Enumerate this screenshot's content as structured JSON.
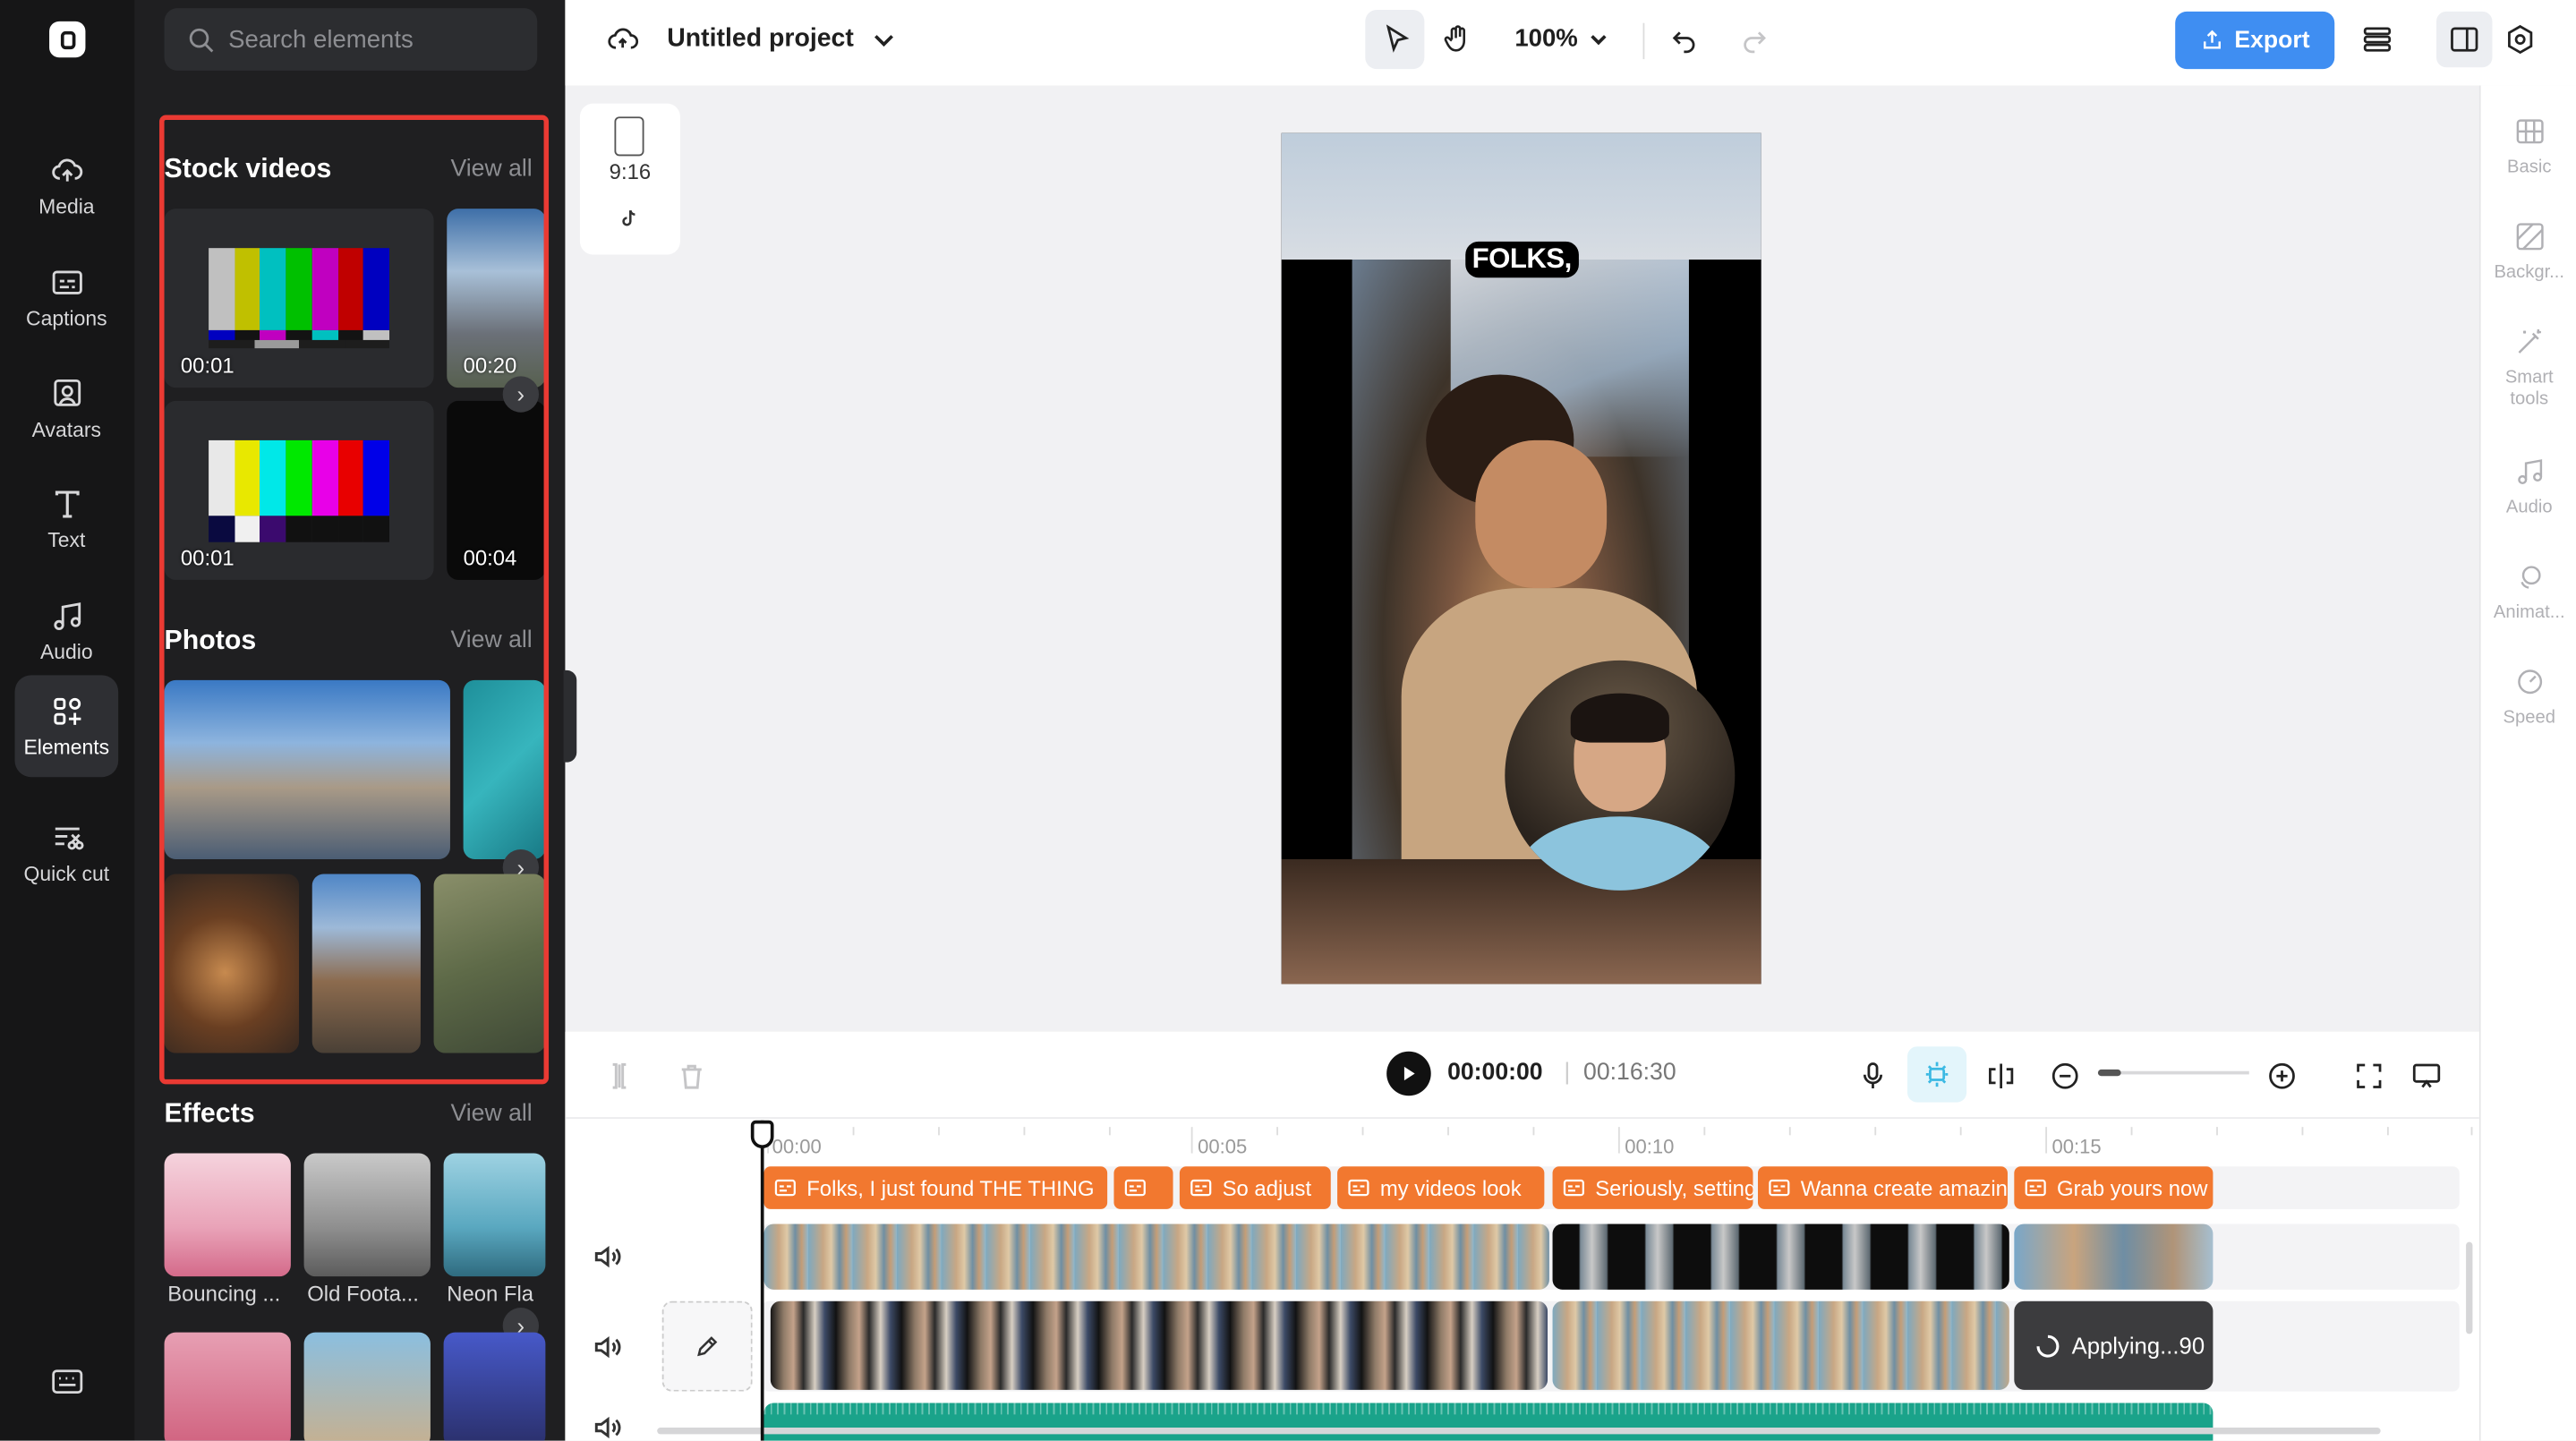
{
  "rail": {
    "items": [
      {
        "label": "Media",
        "icon": "cloud-upload-icon"
      },
      {
        "label": "Captions",
        "icon": "captions-icon"
      },
      {
        "label": "Avatars",
        "icon": "avatar-icon"
      },
      {
        "label": "Text",
        "icon": "text-icon"
      },
      {
        "label": "Audio",
        "icon": "music-note-icon"
      },
      {
        "label": "Elements",
        "icon": "elements-icon"
      },
      {
        "label": "Quick cut",
        "icon": "quick-cut-icon"
      }
    ],
    "active": "Elements"
  },
  "panel": {
    "search_placeholder": "Search elements",
    "stock_videos": {
      "title": "Stock videos",
      "view_all": "View all",
      "durations": [
        "00:01",
        "00:20",
        "00:01",
        "00:04"
      ]
    },
    "photos": {
      "title": "Photos",
      "view_all": "View all"
    },
    "effects": {
      "title": "Effects",
      "view_all": "View all",
      "items": [
        "Bouncing ...",
        "Old Foota...",
        "Neon Fla"
      ]
    }
  },
  "topbar": {
    "project_title": "Untitled project",
    "zoom": "100%",
    "export_label": "Export"
  },
  "canvas": {
    "aspect_ratio": "9:16",
    "caption_text": "FOLKS,"
  },
  "right_rail": {
    "items": [
      "Basic",
      "Backgr...",
      "Smart tools",
      "Audio",
      "Animat...",
      "Speed"
    ]
  },
  "timeline": {
    "current_time": "00:00:00",
    "total_time": "00:16:30",
    "ruler": [
      "00:00",
      "00:05",
      "00:10",
      "00:15"
    ],
    "captions": [
      "Folks, I just found THE THING",
      "",
      "So adjust",
      "my videos look",
      "Seriously, setting",
      "Wanna create amazing",
      "Grab yours now"
    ],
    "applying_label": "Applying...90"
  },
  "colors": {
    "accent": "#3f8ef2",
    "caption_track": "#f2782f",
    "audio_track": "#1aa38a",
    "highlight_border": "#ea3a33"
  }
}
